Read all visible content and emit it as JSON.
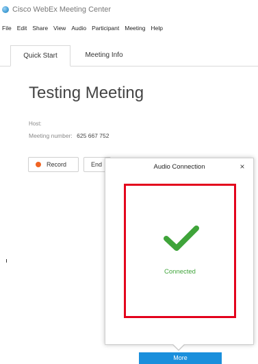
{
  "window": {
    "title": "Cisco WebEx Meeting Center",
    "icon": "webex-logo-icon"
  },
  "menu": {
    "items": [
      "File",
      "Edit",
      "Share",
      "View",
      "Audio",
      "Participant",
      "Meeting",
      "Help"
    ]
  },
  "tabs": [
    {
      "label": "Quick Start",
      "active": true
    },
    {
      "label": "Meeting Info",
      "active": false
    }
  ],
  "meeting": {
    "title": "Testing Meeting",
    "host_label": "Host:",
    "number_label": "Meeting number:",
    "number_value": "625 667 752"
  },
  "buttons": {
    "record_label": "Record",
    "end_label": "End"
  },
  "popup": {
    "title": "Audio Connection",
    "close_glyph": "×",
    "status_text": "Connected",
    "status_icon": "checkmark-icon"
  },
  "more_button": {
    "label": "More"
  },
  "colors": {
    "record_dot": "#f06423",
    "highlight_border": "#e3001b",
    "status_green": "#3fa43a",
    "accent_blue": "#1a8fdc"
  }
}
